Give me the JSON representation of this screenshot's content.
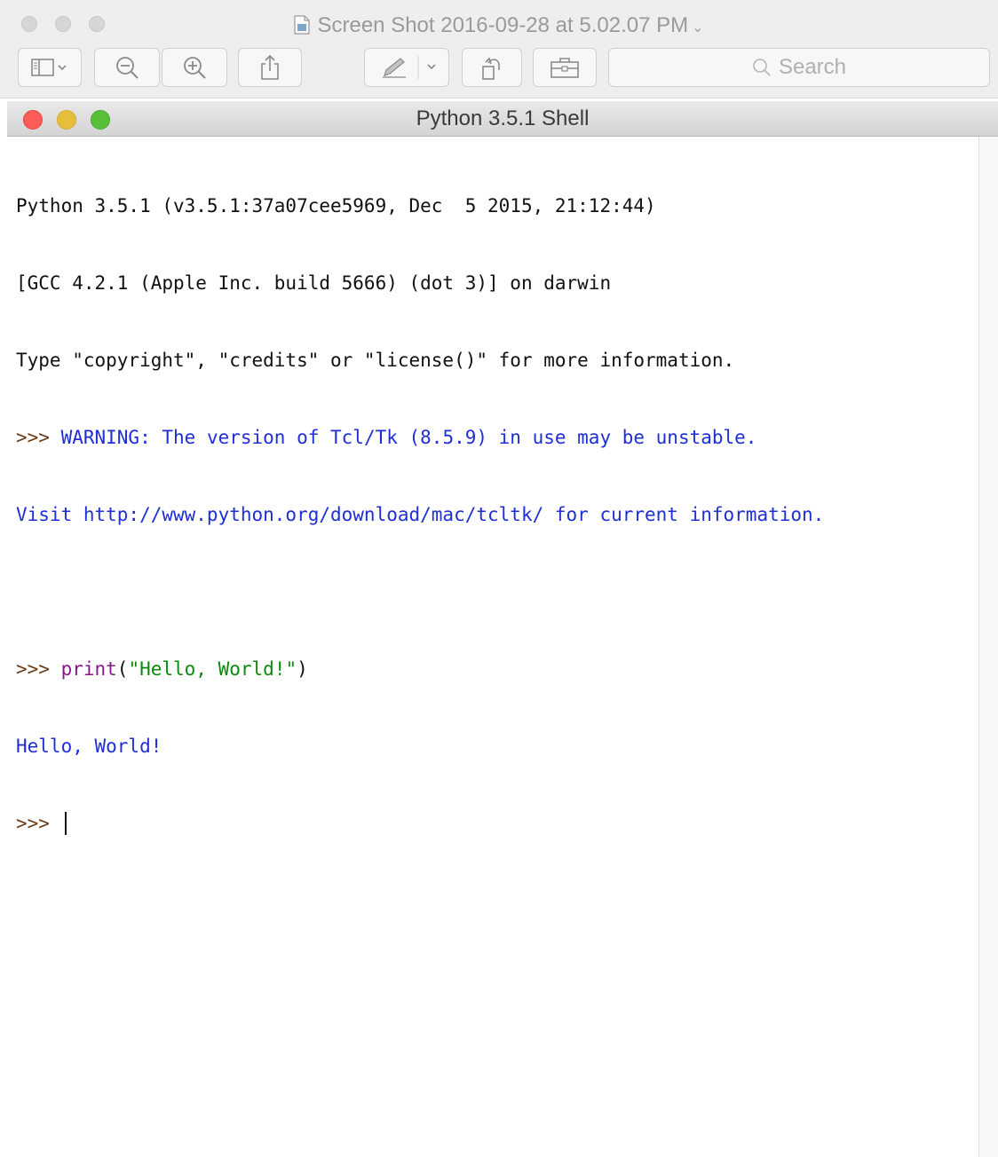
{
  "preview": {
    "title": "Screen Shot 2016-09-28 at 5.02.07 PM",
    "title_chevron": "⌄",
    "search_placeholder": "Search",
    "toolbar_icons": [
      "sidebar-toggle-icon",
      "zoom-out-icon",
      "zoom-in-icon",
      "share-icon",
      "markup-pen-icon",
      "rotate-icon",
      "toolbox-icon",
      "search-icon"
    ]
  },
  "shell": {
    "title": "Python 3.5.1 Shell",
    "lines": {
      "l1": "Python 3.5.1 (v3.5.1:37a07cee5969, Dec  5 2015, 21:12:44) ",
      "l2": "[GCC 4.2.1 (Apple Inc. build 5666) (dot 3)] on darwin",
      "l3": "Type \"copyright\", \"credits\" or \"license()\" for more information.",
      "l4_prompt": ">>> ",
      "l4_warning": "WARNING: The version of Tcl/Tk (8.5.9) in use may be unstable.",
      "l5": "Visit http://www.python.org/download/mac/tcltk/ for current information.",
      "l7_prompt": ">>> ",
      "l7_func": "print",
      "l7_open": "(",
      "l7_string": "\"Hello, World!\"",
      "l7_close": ")",
      "l8": "Hello, World!",
      "l9_prompt": ">>> "
    }
  },
  "colors": {
    "stdout_blue": "#1e2fd6",
    "builtin_purple": "#8a178a",
    "string_green": "#0a8a0a",
    "close": "#fc5b57",
    "minimize": "#e5bf3c",
    "zoom": "#57c038"
  }
}
